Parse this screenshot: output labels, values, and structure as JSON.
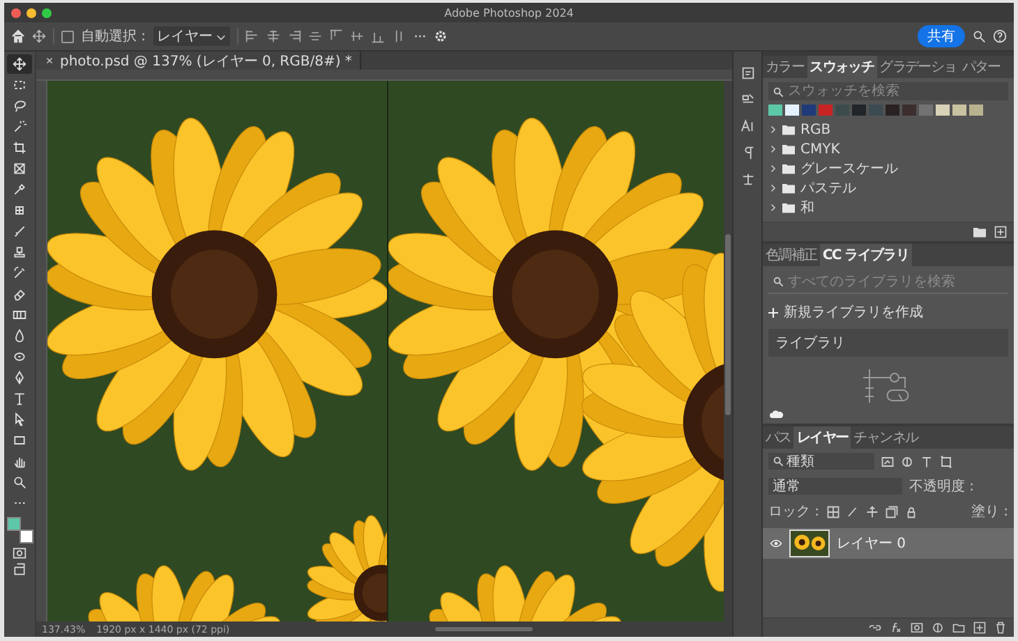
{
  "window": {
    "title": "Adobe Photoshop 2024"
  },
  "options_bar": {
    "auto_select": {
      "label": "自動選択 :",
      "checked": false
    },
    "target": "レイヤー",
    "share_button": "共有"
  },
  "document_tab": {
    "title": "photo.psd @ 137% (レイヤー 0, RGB/8#) *"
  },
  "tools": [
    {
      "kind": "move",
      "selected": true
    },
    {
      "kind": "marquee",
      "selected": false
    },
    {
      "kind": "lasso",
      "selected": false
    },
    {
      "kind": "quick-select",
      "selected": false
    },
    {
      "kind": "crop",
      "selected": false
    },
    {
      "kind": "frame",
      "selected": false
    },
    {
      "kind": "eyedropper",
      "selected": false
    },
    {
      "kind": "healing",
      "selected": false
    },
    {
      "kind": "brush",
      "selected": false
    },
    {
      "kind": "stamp",
      "selected": false
    },
    {
      "kind": "history",
      "selected": false
    },
    {
      "kind": "eraser",
      "selected": false
    },
    {
      "kind": "gradient",
      "selected": false
    },
    {
      "kind": "blur",
      "selected": false
    },
    {
      "kind": "dodge",
      "selected": false
    },
    {
      "kind": "pen",
      "selected": false
    },
    {
      "kind": "type",
      "selected": false
    },
    {
      "kind": "path-select",
      "selected": false
    },
    {
      "kind": "rectangle",
      "selected": false
    },
    {
      "kind": "hand",
      "selected": false
    },
    {
      "kind": "zoom",
      "selected": false
    },
    {
      "kind": "more",
      "selected": false
    }
  ],
  "color_chips": [
    {
      "kind": "foreground",
      "color": "#5cc8a8"
    },
    {
      "kind": "background",
      "color": "#ffffff"
    }
  ],
  "status_bar": {
    "zoom": "137.43%",
    "size": "1920 px x 1440 px (72 ppi)"
  },
  "swatches_panel": {
    "tabs": [
      {
        "label": "カラー",
        "selected": false
      },
      {
        "label": "スウォッチ",
        "selected": true
      },
      {
        "label": "グラデーショ",
        "selected": false
      },
      {
        "label": "パター",
        "selected": false
      }
    ],
    "search": {
      "placeholder": "スウォッチを検索"
    },
    "swatches": [
      {
        "color": "#5cc8a8"
      },
      {
        "color": "#e4f2ff"
      },
      {
        "color": "#1f3a7a"
      },
      {
        "color": "#c82424"
      },
      {
        "color": "#3c4c4c"
      },
      {
        "color": "#22262a"
      },
      {
        "color": "#3c4a52"
      },
      {
        "color": "#2a2222"
      },
      {
        "color": "#3c2e2e"
      },
      {
        "color": "#727272"
      },
      {
        "color": "#d8d2b8"
      },
      {
        "color": "#c8c2a0"
      },
      {
        "color": "#b8b290"
      }
    ],
    "groups": [
      {
        "label": "RGB",
        "expanded": false
      },
      {
        "label": "CMYK",
        "expanded": false
      },
      {
        "label": "グレースケール",
        "expanded": false
      },
      {
        "label": "パステル",
        "expanded": false
      },
      {
        "label": "和",
        "expanded": false
      }
    ]
  },
  "libraries_panel": {
    "tabs": [
      {
        "label": "色調補正",
        "selected": false
      },
      {
        "label": "CC ライブラリ",
        "selected": true
      }
    ],
    "search": {
      "placeholder": "すべてのライブラリを検索"
    },
    "create_button": "新規ライブラリを作成",
    "library_select": "ライブラリ"
  },
  "layers_panel": {
    "tabs": [
      {
        "label": "パス",
        "selected": false
      },
      {
        "label": "レイヤー",
        "selected": true
      },
      {
        "label": "チャンネル",
        "selected": false
      }
    ],
    "filter": "種類",
    "blend_mode": "通常",
    "opacity_label": "不透明度 :",
    "lock_label": "ロック :",
    "fill_label": "塗り :",
    "layers": [
      {
        "name": "レイヤー 0",
        "visible": true,
        "selected": true
      }
    ]
  }
}
